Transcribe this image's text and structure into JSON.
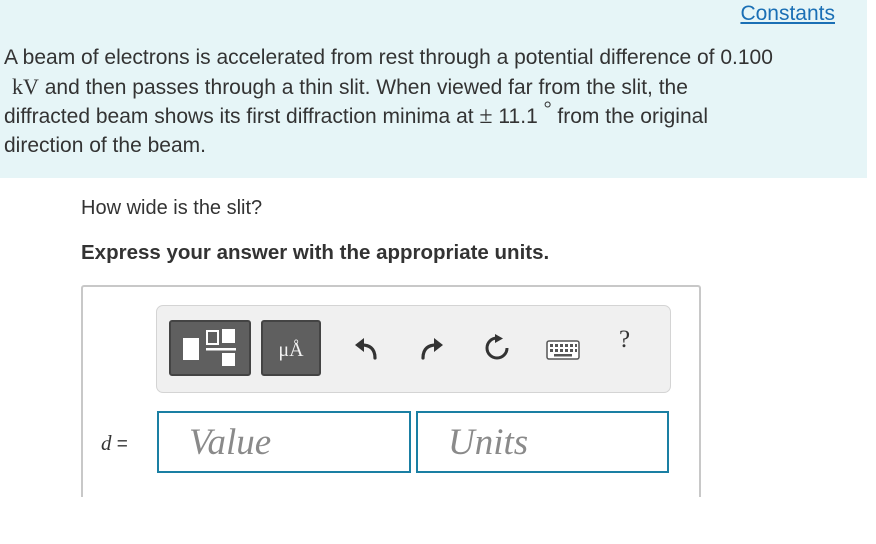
{
  "header": {
    "constants_link": "Constants"
  },
  "problem": {
    "line1": "A beam of electrons is accelerated from rest through a potential difference of 0.100",
    "line2_unit": "kV",
    "line2_rest": " and then passes through a thin slit. When viewed far from the slit, the",
    "line3_pre": "diffracted beam shows its first diffraction minima at ",
    "line3_pm": "±",
    "line3_value": " 11.1 ",
    "line3_deg": "°",
    "line3_post": " from the original",
    "line4": "direction of the beam."
  },
  "question": {
    "text": "How wide is the slit?",
    "instruction": "Express your answer with the appropriate units."
  },
  "toolbar": {
    "units_button": "μÅ",
    "help": "?",
    "icons": [
      "templates-icon",
      "units-icon",
      "undo-icon",
      "redo-icon",
      "reset-icon",
      "keyboard-icon",
      "help-icon"
    ]
  },
  "answer": {
    "variable": "d",
    "equals": " =",
    "value_placeholder": "Value",
    "units_placeholder": "Units"
  },
  "colors": {
    "intro_bg": "#e6f5f7",
    "link": "#1a6fb5",
    "field_border": "#1a7fa3",
    "button_bg": "#5f5f5f"
  }
}
